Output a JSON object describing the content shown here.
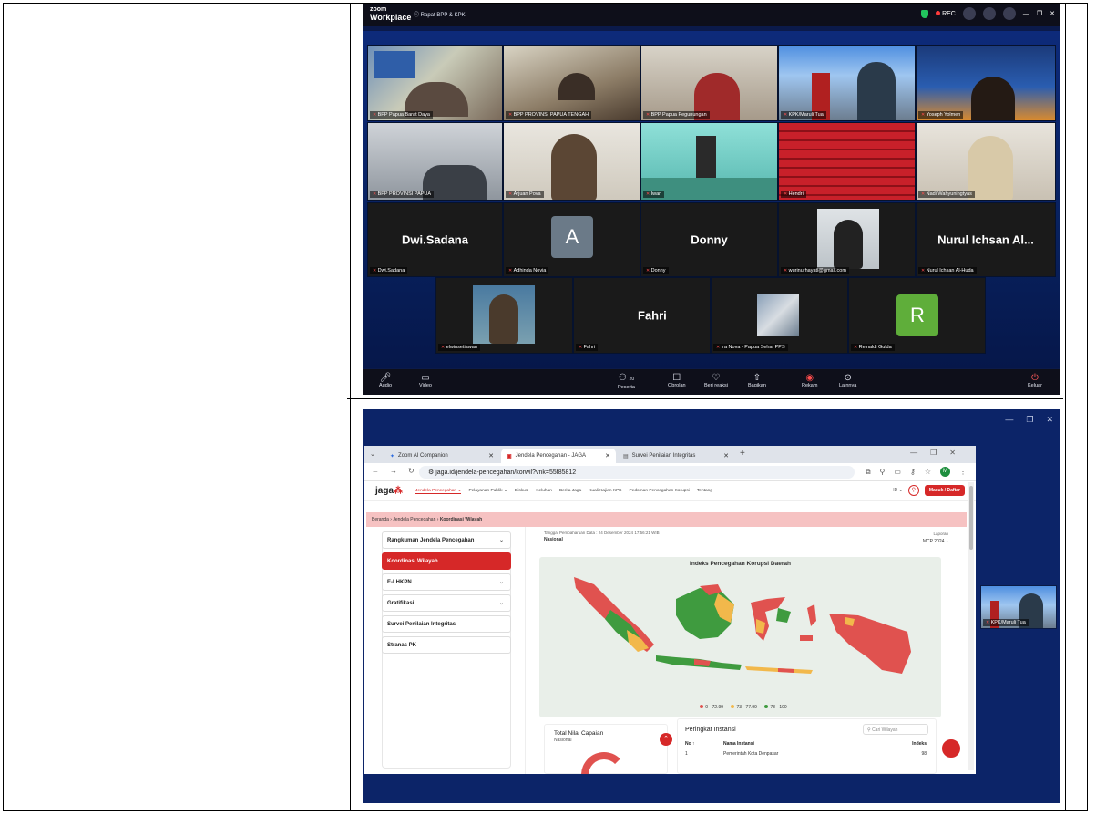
{
  "zoom": {
    "logo_small": "zoom",
    "logo_big": "Workplace",
    "meeting_title": "ⓘ Rapat BPP & KPK",
    "rec_label": "REC",
    "tiles": [
      {
        "label": "BPP Papua Barat Daya"
      },
      {
        "label": "BPP PROVINSI PAPUA TENGAH"
      },
      {
        "label": "BPP Papua Pegunungan"
      },
      {
        "label": "KPK/Maruli Tua"
      },
      {
        "label": "Yoseph Yolmen"
      },
      {
        "label": "BPP PROVINSI PAPUA"
      },
      {
        "label": "Arjuan Pova"
      },
      {
        "label": "Iwan"
      },
      {
        "label": "Hendri"
      },
      {
        "label": "Nadi Wahyuningtyas"
      },
      {
        "label": "Dwi.Sadana",
        "name": "Dwi.Sadana"
      },
      {
        "label": "Adhinda Novia",
        "avatar": "A"
      },
      {
        "label": "Donny",
        "name": "Donny"
      },
      {
        "label": "wurinurhayati@gmail.com"
      },
      {
        "label": "Nurul Ichsan Al-Huda",
        "name": "Nurul Ichsan Al..."
      },
      {
        "label": "elwinsetiawan"
      },
      {
        "label": "Fahri",
        "name": "Fahri"
      },
      {
        "label": "Ira Nova - Papua Sehat PPS"
      },
      {
        "label": "Reinaldi Gulda",
        "avatar": "R"
      }
    ],
    "toolbar": {
      "audio": "Audio",
      "video": "Video",
      "participants": "Peserta",
      "participants_count": "20",
      "chat": "Obrolan",
      "react": "Beri reaksi",
      "share": "Bagikan",
      "record": "Rekam",
      "more": "Lainnya",
      "leave": "Keluar"
    }
  },
  "browser": {
    "tabs": [
      {
        "label": "Zoom AI Companion"
      },
      {
        "label": "Jendela Pencegahan - JAGA"
      },
      {
        "label": "Survei Penilaian Integritas"
      }
    ],
    "url": "jaga.id/jendela-pencegahan/korwil?vnk=55f85812",
    "account_initial": "M"
  },
  "jaga": {
    "logo": "jaga",
    "menu": [
      "Jendela Pencegahan ⌄",
      "Pelayanan Publik ⌄",
      "Diskusi",
      "Keluhan",
      "Berita Jaga",
      "Kuali Kajian KPK",
      "Pedoman Pencegahan Korupsi",
      "Tentang"
    ],
    "lang": "ID",
    "login": "Masuk / Daftar",
    "breadcrumb": {
      "home": "Beranda",
      "mid": "Jendela Pencegahan",
      "current": "Koordinasi Wilayah"
    },
    "sidebar": [
      {
        "label": "Rangkuman Jendela Pencegahan",
        "chev": "⌄"
      },
      {
        "label": "Koordinasi Wilayah",
        "chev": ""
      },
      {
        "label": "E-LHKPN",
        "chev": "⌄"
      },
      {
        "label": "Gratifikasi",
        "chev": "⌄"
      },
      {
        "label": "Survei Penilaian Integritas",
        "chev": ""
      },
      {
        "label": "Stranas PK",
        "chev": ""
      }
    ],
    "update_text": "Tanggal Pembaharuan Data : 24 Desember 2024 17:56:21 WIB",
    "scope": "Nasional",
    "year_label": "Laporan",
    "year_value": "MCP 2024 ⌄",
    "map_title": "Indeks Pencegahan Korupsi Daerah",
    "legend": [
      {
        "label": "0 - 72.99",
        "color": "#e0524f"
      },
      {
        "label": "73 - 77.99",
        "color": "#f2b84b"
      },
      {
        "label": "78 - 100",
        "color": "#3f9b3f"
      }
    ],
    "total_title": "Total Nilai Capaian",
    "total_sub": "Nasional",
    "rank_title": "Peringkat Instansi",
    "rank_search": "Cari Wilayah",
    "rank_head": {
      "no": "No ↑",
      "name": "Nama Instansi",
      "index": "Indeks"
    },
    "rank_first": {
      "no": "1",
      "name": "Pemerintah Kota Denpasar",
      "index": "98"
    }
  },
  "pip_label": "KPK/Maruli Tua"
}
